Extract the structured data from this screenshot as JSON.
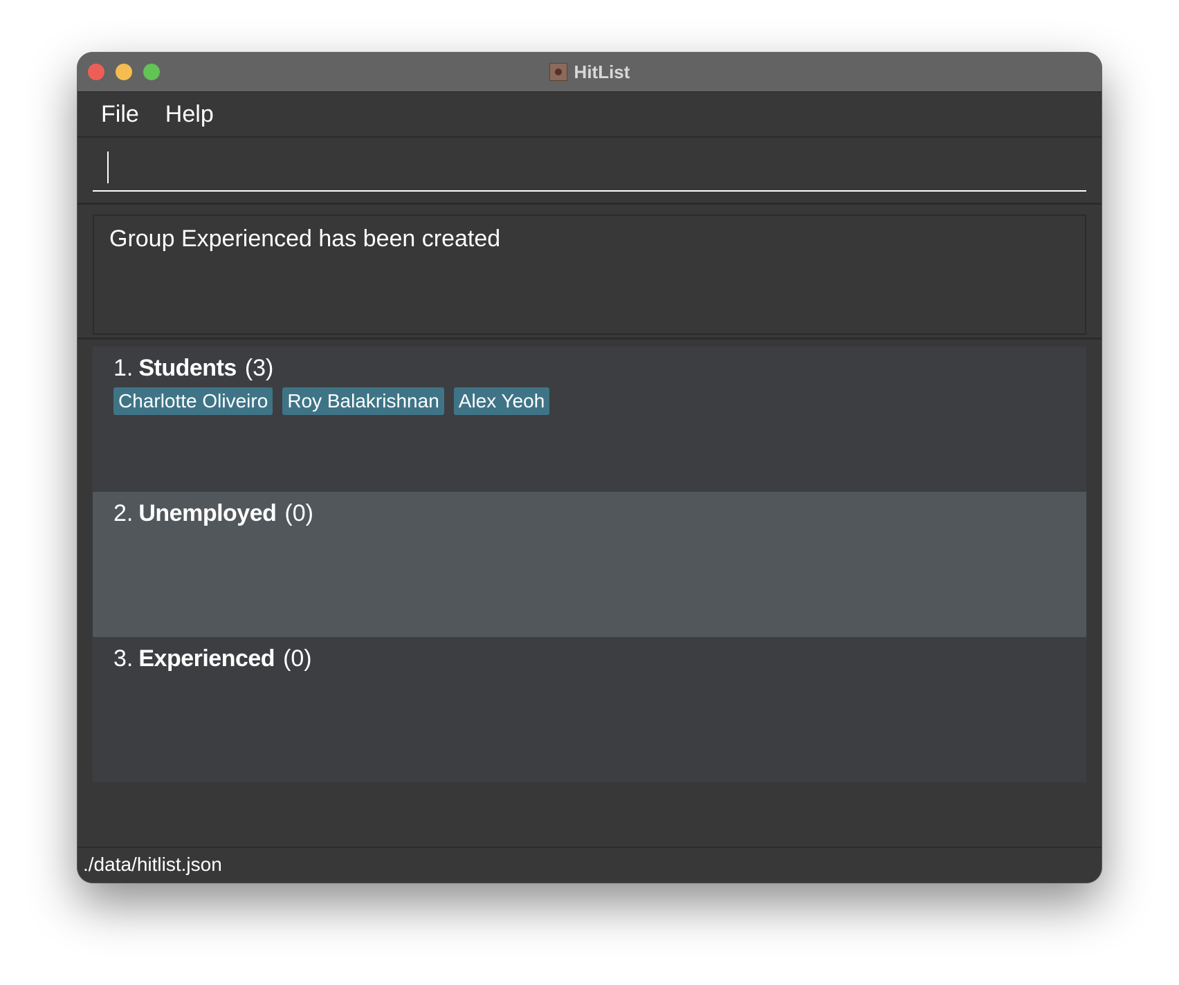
{
  "window": {
    "title": "HitList"
  },
  "menu": {
    "file": "File",
    "help": "Help"
  },
  "command_box": {
    "value": "",
    "placeholder": ""
  },
  "result_display": {
    "message": "Group Experienced has been created"
  },
  "groups": [
    {
      "index": "1.",
      "name": "Students",
      "count": "(3)",
      "members": [
        "Charlotte Oliveiro",
        "Roy Balakrishnan",
        "Alex Yeoh"
      ]
    },
    {
      "index": "2.",
      "name": "Unemployed",
      "count": "(0)",
      "members": []
    },
    {
      "index": "3.",
      "name": "Experienced",
      "count": "(0)",
      "members": []
    }
  ],
  "status_bar": {
    "file_path": "./data/hitlist.json"
  },
  "colors": {
    "background": "#383838",
    "titlebar": "#636363",
    "tag": "#3f7487",
    "card_odd": "#3c3e41",
    "card_even": "#51575b"
  }
}
